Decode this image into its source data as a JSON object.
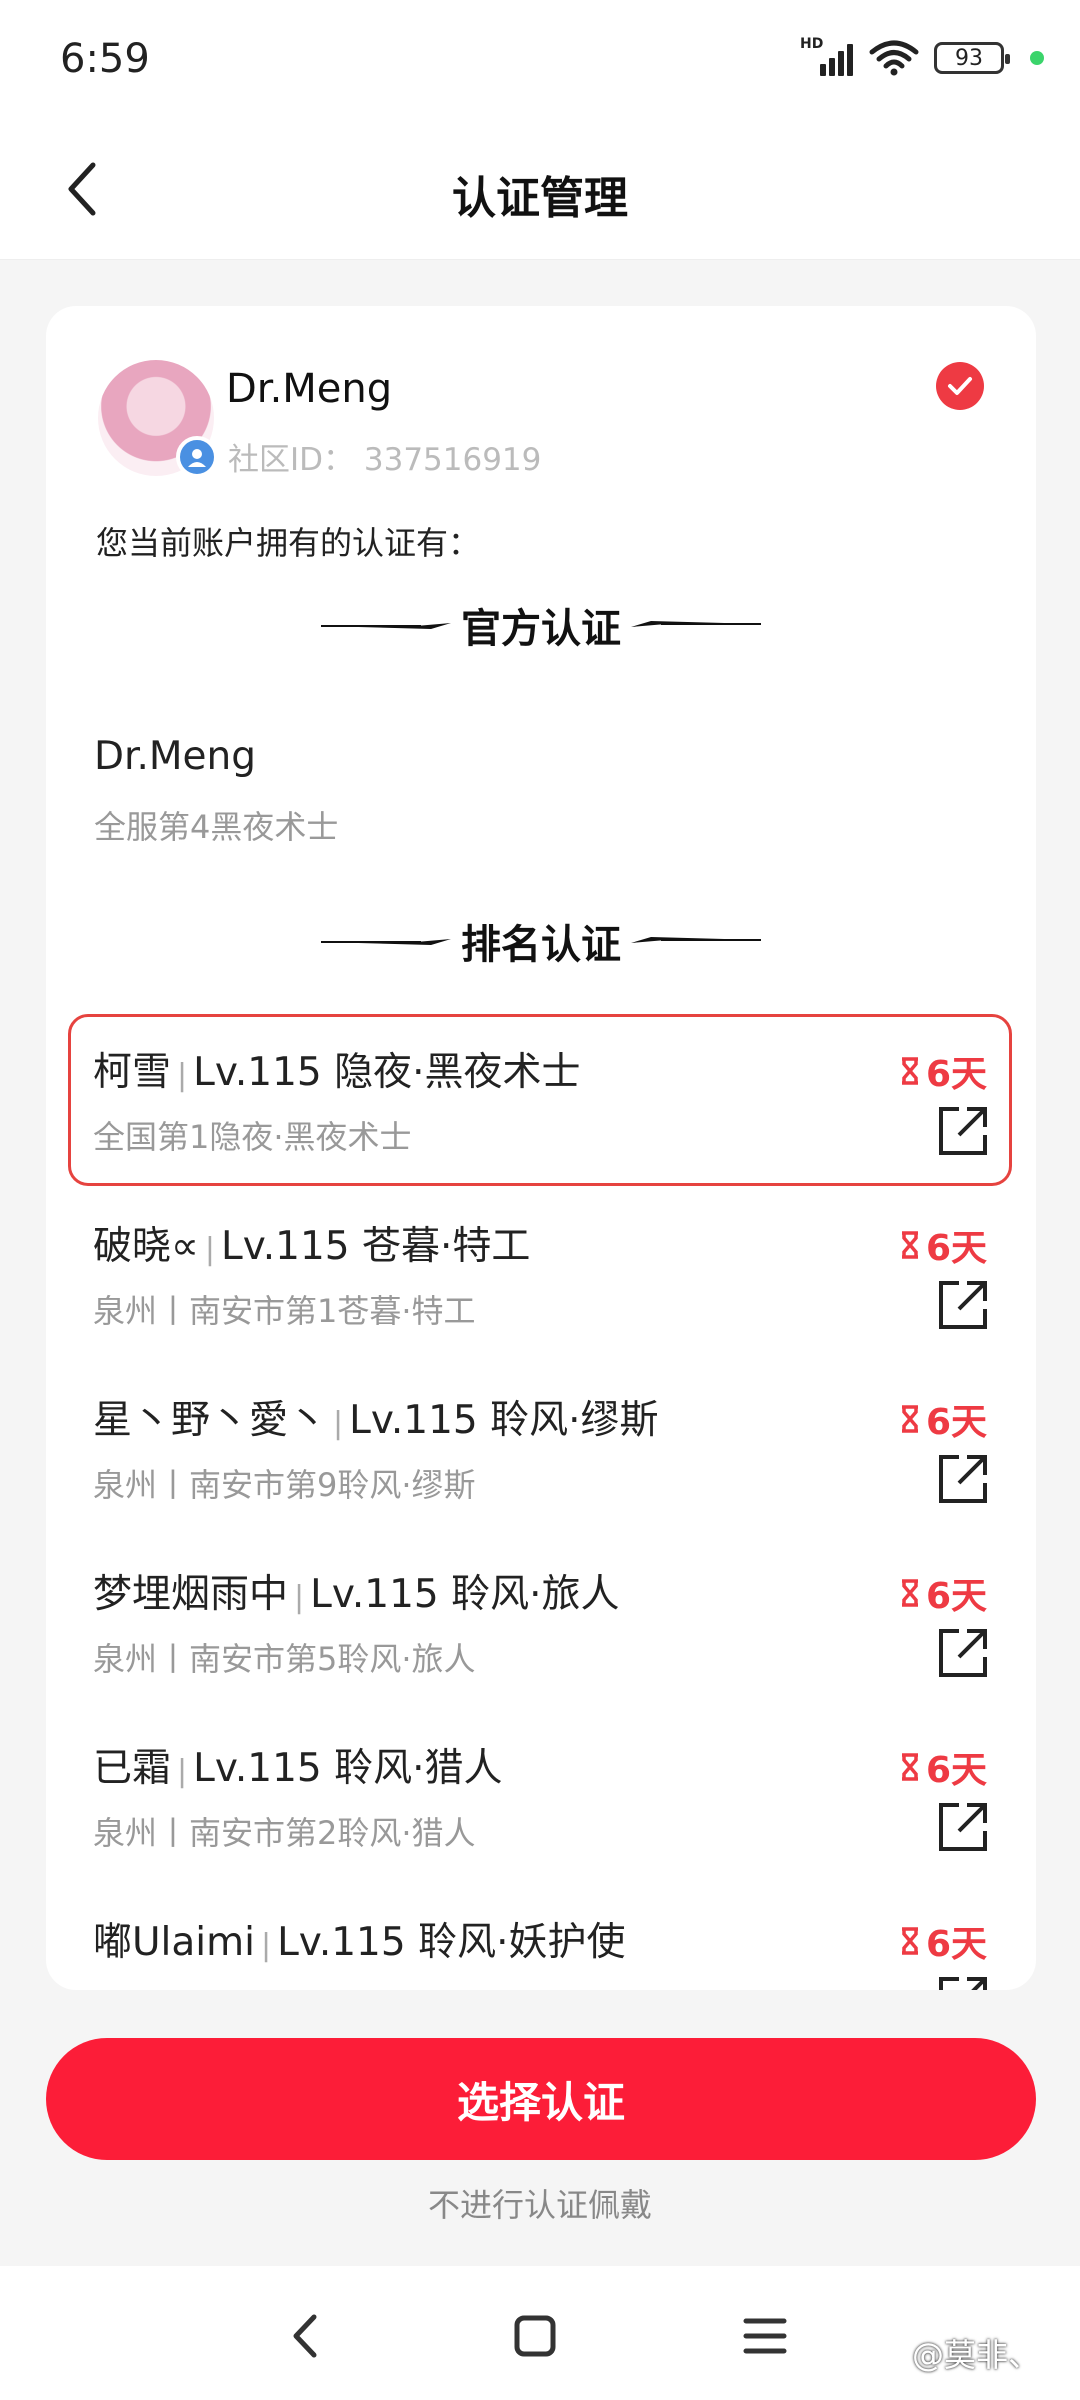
{
  "status_bar": {
    "time": "6:59",
    "battery": "93",
    "signal_tag": "HD"
  },
  "nav": {
    "title": "认证管理"
  },
  "profile": {
    "name": "Dr.Meng",
    "community_id": "社区ID：  337516919"
  },
  "intro": "您当前账户拥有的认证有：",
  "official": {
    "header": "官方认证",
    "name": "Dr.Meng",
    "desc": "全服第4黑夜术士"
  },
  "ranking": {
    "header": "排名认证",
    "items": [
      {
        "name": "柯雪",
        "detail": "Lv.115 隐夜·黑夜术士",
        "sub": "全国第1隐夜·黑夜术士",
        "days": "6天",
        "selected": true
      },
      {
        "name": "破晓∝",
        "detail": "Lv.115 苍暮·特工",
        "sub": "泉州丨南安市第1苍暮·特工",
        "days": "6天",
        "selected": false
      },
      {
        "name": "星丶野丶愛丶",
        "detail": "Lv.115 聆风·缪斯",
        "sub": "泉州丨南安市第9聆风·缪斯",
        "days": "6天",
        "selected": false
      },
      {
        "name": "梦埋烟雨中",
        "detail": "Lv.115 聆风·旅人",
        "sub": "泉州丨南安市第5聆风·旅人",
        "days": "6天",
        "selected": false
      },
      {
        "name": "已霜",
        "detail": "Lv.115 聆风·猎人",
        "sub": "泉州丨南安市第2聆风·猎人",
        "days": "6天",
        "selected": false
      },
      {
        "name": "嘟Ulaimi",
        "detail": "Lv.115 聆风·妖护使",
        "sub": "",
        "days": "6天",
        "selected": false
      }
    ]
  },
  "actions": {
    "primary": "选择认证",
    "secondary": "不进行认证佩戴"
  },
  "watermark": "@莫非、",
  "colors": {
    "accent": "#fc1d38",
    "selected_border": "#e6433f",
    "days": "#ee3a43"
  }
}
